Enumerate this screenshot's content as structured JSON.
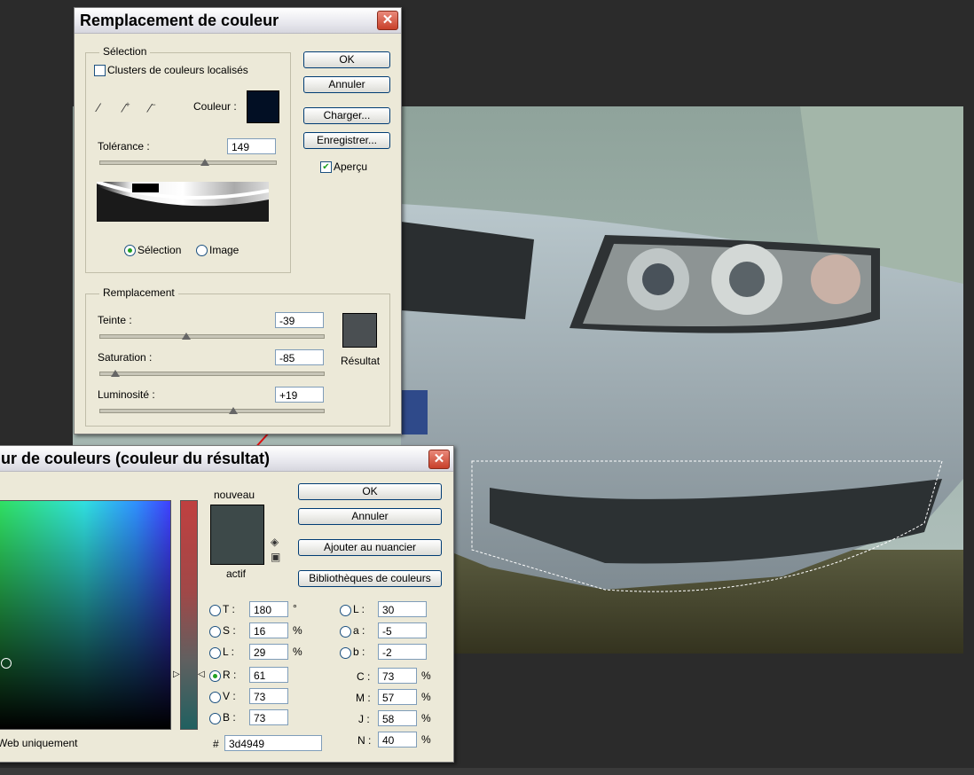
{
  "colors": {
    "couleur_swatch": "#020f24",
    "result_swatch": "#4a4f52",
    "new_color": "#3d4949",
    "accent_arrow": "#e01010"
  },
  "replace_dialog": {
    "title": "Remplacement de couleur",
    "close_icon": "close-icon",
    "selection": {
      "legend": "Sélection",
      "localized_clusters_label": "Clusters de couleurs localisés",
      "localized_clusters_checked": false,
      "eyedropper_icons": [
        "eyedropper-icon",
        "eyedropper-plus-icon",
        "eyedropper-minus-icon"
      ],
      "color_label": "Couleur :",
      "tolerance_label": "Tolérance :",
      "tolerance_value": "149",
      "tolerance_level": 0.6,
      "radio_selection": "Sélection",
      "radio_image": "Image",
      "selected_view": "Sélection"
    },
    "replacement": {
      "legend": "Remplacement",
      "hue_label": "Teinte :",
      "hue_value": "-39",
      "hue_level": 0.39,
      "saturation_label": "Saturation :",
      "saturation_value": "-85",
      "saturation_level": 0.07,
      "lightness_label": "Luminosité :",
      "lightness_value": "+19",
      "lightness_level": 0.6,
      "result_label": "Résultat"
    },
    "buttons": {
      "ok": "OK",
      "cancel": "Annuler",
      "load": "Charger...",
      "save": "Enregistrer..."
    },
    "preview_label": "Aperçu",
    "preview_checked": true
  },
  "picker_dialog": {
    "title": "ur de couleurs (couleur du résultat)",
    "close_icon": "close-icon",
    "new_label": "nouveau",
    "current_label": "actif",
    "buttons": {
      "ok": "OK",
      "cancel": "Annuler",
      "add_swatch": "Ajouter au nuancier",
      "libraries": "Bibliothèques de couleurs"
    },
    "web_only_label": "Web uniquement",
    "hsb": [
      {
        "label": "T :",
        "value": "180",
        "unit": "°"
      },
      {
        "label": "S :",
        "value": "16",
        "unit": "%"
      },
      {
        "label": "L :",
        "value": "29",
        "unit": "%"
      }
    ],
    "rgb": [
      {
        "label": "R :",
        "value": "61",
        "unit": ""
      },
      {
        "label": "V :",
        "value": "73",
        "unit": ""
      },
      {
        "label": "B :",
        "value": "73",
        "unit": ""
      }
    ],
    "lab": [
      {
        "label": "L :",
        "value": "30"
      },
      {
        "label": "a :",
        "value": "-5"
      },
      {
        "label": "b :",
        "value": "-2"
      }
    ],
    "cmyk": [
      {
        "label": "C :",
        "value": "73",
        "unit": "%"
      },
      {
        "label": "M :",
        "value": "57",
        "unit": "%"
      },
      {
        "label": "J :",
        "value": "58",
        "unit": "%"
      },
      {
        "label": "N :",
        "value": "40",
        "unit": "%"
      }
    ],
    "hex_label": "#",
    "hex_value": "3d4949",
    "selected_channel": "R"
  }
}
